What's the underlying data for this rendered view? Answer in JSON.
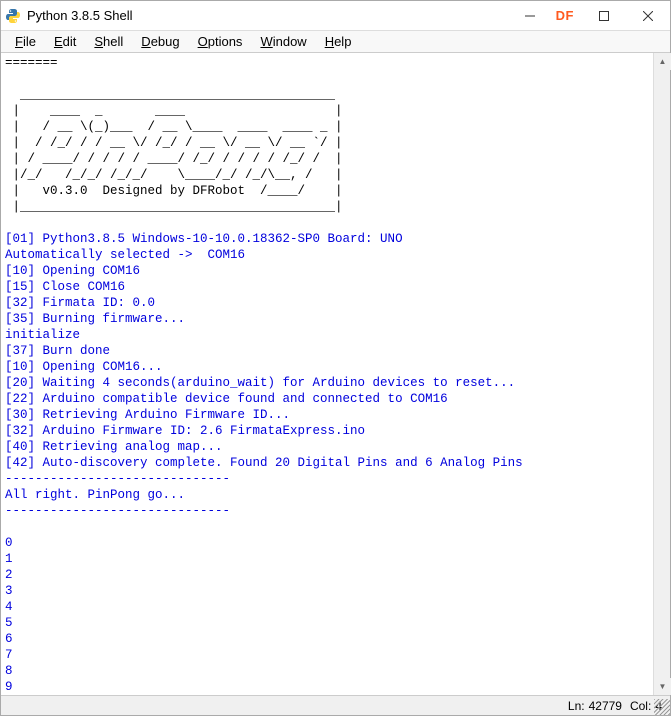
{
  "window": {
    "title": "Python 3.8.5 Shell",
    "watermark": "DF"
  },
  "menu": {
    "items": [
      "File",
      "Edit",
      "Shell",
      "Debug",
      "Options",
      "Window",
      "Help"
    ]
  },
  "console": {
    "top_black": "=======",
    "ascii_art": "\n  __________________________________________\n |    ____  _       ____                    |\n |   / __ \\(_)___  / __ \\____  ____  ____ _ |\n |  / /_/ / / __ \\/ /_/ / __ \\/ __ \\/ __ `/ |\n | / ____/ / / / / ____/ /_/ / / / / /_/ /  |\n |/_/   /_/_/ /_/_/    \\____/_/ /_/\\__, /   |\n |   v0.3.0  Designed by DFRobot  /____/    |\n |__________________________________________|\n",
    "line_board": "[01] Python3.8.5 Windows-10-10.0.18362-SP0 Board: UNO",
    "line_auto_selected": "Automatically selected ->  COM16",
    "line_open_com": "[10] Opening COM16",
    "line_close_com": "[15] Close COM16",
    "line_firmata_id": "[32] Firmata ID: 0.0",
    "line_burning": "[35] Burning firmware...",
    "line_initialize": "initialize",
    "line_burn_done": "[37] Burn done",
    "line_open_com2": "[10] Opening COM16...",
    "line_waiting": "[20] Waiting 4 seconds(arduino_wait) for Arduino devices to reset...",
    "line_compatible": "[22] Arduino compatible device found and connected to COM16",
    "line_retrieving_fw": "[30] Retrieving Arduino Firmware ID...",
    "line_fw_id": "[32] Arduino Firmware ID: 2.6 FirmataExpress.ino",
    "line_analog_map": "[40] Retrieving analog map...",
    "line_auto_discovery": "[42] Auto-discovery complete. Found 20 Digital Pins and 6 Analog Pins",
    "dashes1": "------------------------------",
    "line_allright": "All right. PinPong go...",
    "dashes2": "------------------------------",
    "numbers": [
      "0",
      "1",
      "2",
      "3",
      "4",
      "5",
      "6",
      "7",
      "8",
      "9"
    ]
  },
  "status": {
    "ln_label": "Ln:",
    "ln_value": "42779",
    "col_label": "Col:",
    "col_value": "4"
  }
}
